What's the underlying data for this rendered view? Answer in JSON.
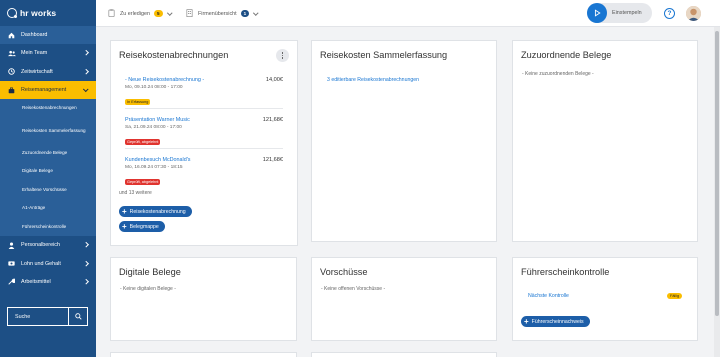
{
  "app": {
    "logo_text": "hr works"
  },
  "sidebar": {
    "items": [
      {
        "label": "Dashboard",
        "icon": "home-icon"
      },
      {
        "label": "Mein Team",
        "icon": "team-icon"
      },
      {
        "label": "Zeitwirtschaft",
        "icon": "clock-icon"
      },
      {
        "label": "Reisemanagement",
        "icon": "suitcase-icon"
      },
      {
        "label": "Personalbereich",
        "icon": "person-icon"
      },
      {
        "label": "Lohn und Gehalt",
        "icon": "money-icon"
      },
      {
        "label": "Arbeitsmittel",
        "icon": "tools-icon"
      }
    ],
    "subitems": [
      "Reisekostenabrechnungen",
      "Reisekosten Sammelerfassung",
      "Zuzuordnende Belege",
      "Digitale Belege",
      "Erhaltene Vorschüsse",
      "A1-Anträge",
      "Führerscheinkontrolle"
    ],
    "search_placeholder": "Suche"
  },
  "topbar": {
    "todo_label": "Zu erledigen",
    "todo_count": "5",
    "company_label": "Firmenübersicht",
    "company_count": "1",
    "stamp_label": "Einstempeln",
    "help_glyph": "?"
  },
  "cards": {
    "reisekosten": {
      "title": "Reisekostenabrechnungen",
      "entries": [
        {
          "title": "- Neue Reisekostenabrechnung -",
          "date": "Mo, 09.10.24 08:00 - 17:00",
          "amount": "14,00€",
          "status": "In Erfassung",
          "status_color": "#fabd00"
        },
        {
          "title": "Präsentation Warner Music",
          "date": "Sa, 21.09.24 08:00 - 17:00",
          "amount": "121,68€",
          "status": "Geprüft, abgelehnt",
          "status_color": "#e0342f"
        },
        {
          "title": "Kundenbesuch McDonald's",
          "date": "Mo, 16.09.24 07:30 - 18:15",
          "amount": "121,68€",
          "status": "Geprüft, abgelehnt",
          "status_color": "#e0342f"
        }
      ],
      "more_text": "und 13 weitere",
      "btn_new": "Reisekostenabrechnung",
      "btn_folder": "Belegmappe"
    },
    "sammel": {
      "title": "Reisekosten Sammelerfassung",
      "link": "3 editierbare Reisekostenabrechnungen"
    },
    "zuordnen": {
      "title": "Zuzuordnende Belege",
      "empty": "- Keine zuzuordnenden Belege -"
    },
    "digital": {
      "title": "Digitale Belege",
      "empty": "- Keine digitalen Belege -"
    },
    "vorschuss": {
      "title": "Vorschüsse",
      "empty": "- Keine offenen Vorschüsse -"
    },
    "fuehrer": {
      "title": "Führerscheinkontrolle",
      "link": "Nächste Kontrolle",
      "badge": "Fällig",
      "btn": "Führerscheinnachweis"
    }
  },
  "colors": {
    "sidebar": "#1d4f85",
    "accent": "#fabd00",
    "primary": "#1d5ea8",
    "danger": "#e0342f"
  }
}
